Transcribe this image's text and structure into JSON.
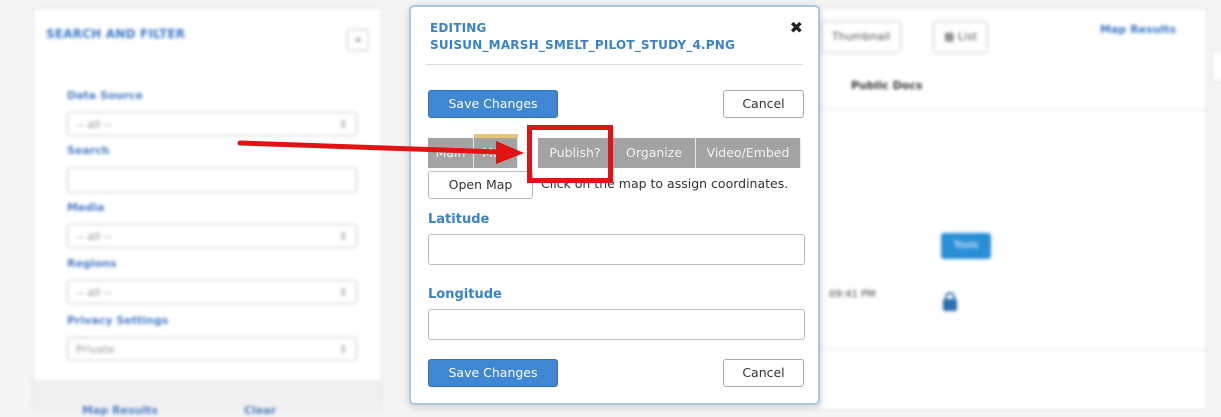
{
  "sidebar": {
    "header": "SEARCH AND FILTER",
    "toggle": "»",
    "data_source_label": "Data Source",
    "data_source_value": "-- all --",
    "search_label": "Search",
    "media_label": "Media",
    "media_value": "-- all --",
    "regions_label": "Regions",
    "regions_value": "-- all --",
    "privacy_label": "Privacy Settings",
    "privacy_value": "Private",
    "map_results": "Map Results",
    "clear": "Clear"
  },
  "content": {
    "thumbnail_btn": "Thumbnail",
    "list_btn": "List",
    "map_results_link": "Map Results",
    "public_docs_header": "Public Docs",
    "tag_chip": "Tools",
    "time_text": "09:41 PM"
  },
  "modal": {
    "title_line1": "EDITING",
    "title_line2": "SUISUN_MARSH_SMELT_PILOT_STUDY_4.PNG",
    "close": "✖",
    "save_top": "Save Changes",
    "cancel_top": "Cancel",
    "tabs": [
      "Main",
      "Map",
      "Publish?",
      "Organize",
      "Video/Embed"
    ],
    "open_map": "Open Map",
    "hint": "Click on the map to assign coordinates.",
    "latitude_label": "Latitude",
    "latitude_value": "",
    "longitude_label": "Longitude",
    "longitude_value": "",
    "save_bottom": "Save Changes",
    "cancel_bottom": "Cancel"
  },
  "colors": {
    "accent": "#3a82c9",
    "primary_button": "#3f86d3",
    "tab_gray": "#a3a3a3",
    "annotation_red": "#e01414"
  }
}
